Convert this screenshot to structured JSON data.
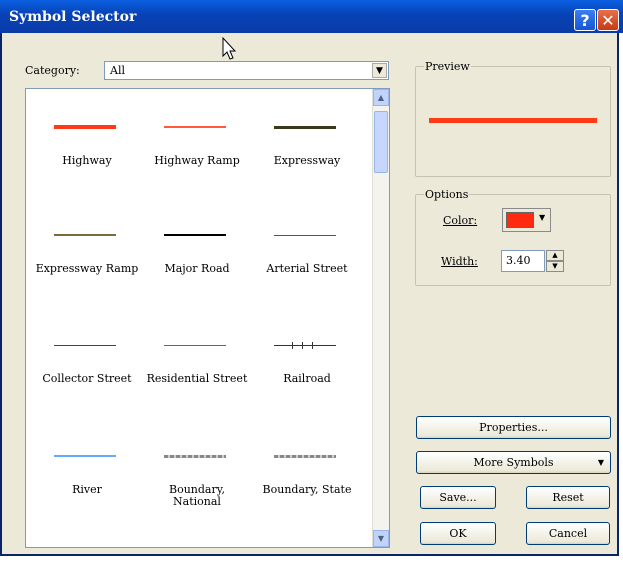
{
  "window": {
    "title": "Symbol Selector"
  },
  "category": {
    "label": "Category:",
    "value": "All"
  },
  "symbols": [
    {
      "label": "Highway",
      "color": "#ff3a17"
    },
    {
      "label": "Highway Ramp",
      "color": "#ff5a3a"
    },
    {
      "label": "Expressway",
      "color": "#3a3a1a"
    },
    {
      "label": "Expressway Ramp",
      "color": "#7d6a3a"
    },
    {
      "label": "Major Road",
      "color": "#000000"
    },
    {
      "label": "Arterial Street",
      "color": "#555555"
    },
    {
      "label": "Collector Street",
      "color": "#444444"
    },
    {
      "label": "Residential Street",
      "color": "#666666"
    },
    {
      "label": "Railroad",
      "color": "#333333"
    },
    {
      "label": "River",
      "color": "#66aaff"
    },
    {
      "label": "Boundary, National",
      "color": "#888888"
    },
    {
      "label": "Boundary, State",
      "color": "#888888"
    }
  ],
  "preview": {
    "title": "Preview",
    "color": "#ff3a17"
  },
  "options": {
    "title": "Options",
    "color_label": "Color:",
    "color_value": "#ff2a10",
    "width_label": "Width:",
    "width_value": "3.40"
  },
  "buttons": {
    "properties": "Properties...",
    "more_symbols": "More Symbols",
    "save": "Save...",
    "reset": "Reset",
    "ok": "OK",
    "cancel": "Cancel"
  }
}
